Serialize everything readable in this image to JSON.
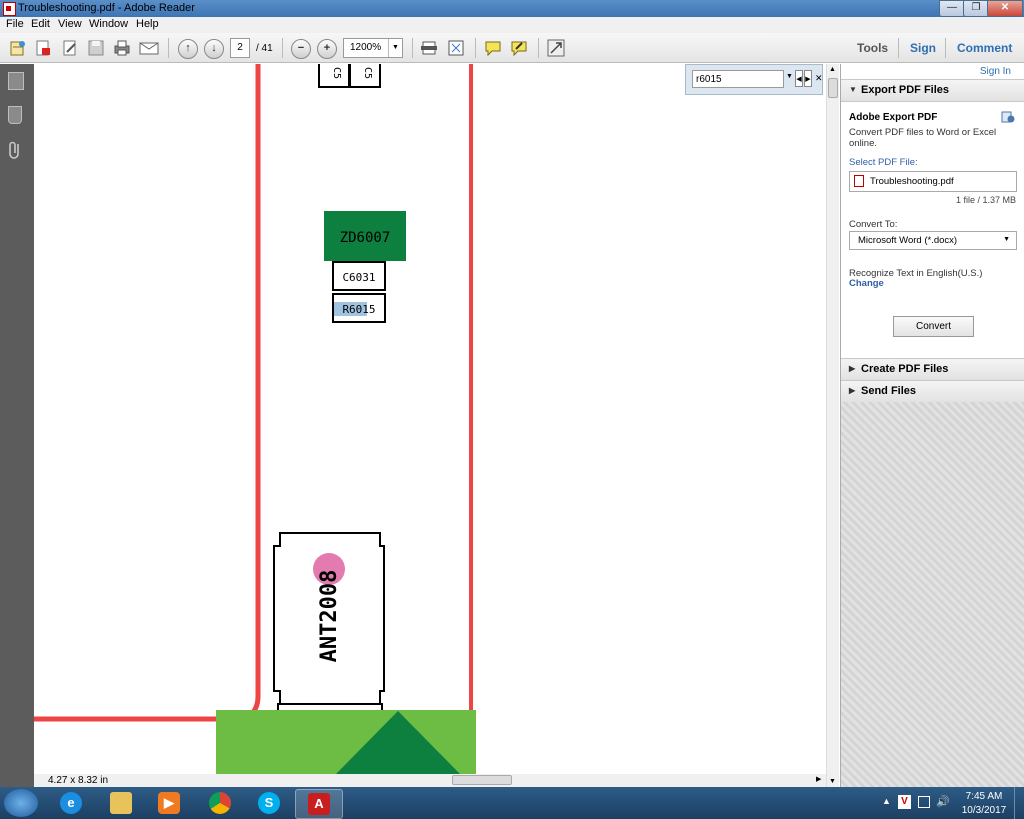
{
  "window": {
    "title": "Troubleshooting.pdf - Adobe Reader",
    "controls": {
      "minimize": "—",
      "maximize": "❐",
      "close": "✕"
    }
  },
  "menu": [
    "File",
    "Edit",
    "View",
    "Window",
    "Help"
  ],
  "toolbar": {
    "page_current": "2",
    "page_total": "/ 41",
    "zoom": "1200%",
    "panes": [
      "Tools",
      "Sign",
      "Comment"
    ]
  },
  "find": {
    "value": "r6015"
  },
  "document": {
    "labels": {
      "c_top_1": "C5",
      "c_top_2": "C5",
      "zd": "ZD6007",
      "c6031": "C6031",
      "r6015": "R6015",
      "ant": "ANT2008"
    },
    "colors": {
      "trace": "#ee4444",
      "green_dark": "#0d7f3e",
      "green_light": "#6dbd44",
      "highlight": "#9fc3e0",
      "marker": "#e47bb0"
    }
  },
  "status": {
    "page_size": "4.27 x 8.32 in"
  },
  "right_pane": {
    "sign_in": "Sign In",
    "export": {
      "title": "Export PDF Files",
      "service": "Adobe Export PDF",
      "description": "Convert PDF files to Word or Excel online.",
      "select_label": "Select PDF File:",
      "file_name": "Troubleshooting.pdf",
      "file_info": "1 file / 1.37 MB",
      "convert_to_label": "Convert To:",
      "format": "Microsoft Word (*.docx)",
      "recognize": "Recognize Text in English(U.S.)",
      "change": "Change",
      "convert_btn": "Convert"
    },
    "create": "Create PDF Files",
    "send": "Send Files"
  },
  "taskbar": {
    "time": "7:45 AM",
    "date": "10/3/2017"
  }
}
